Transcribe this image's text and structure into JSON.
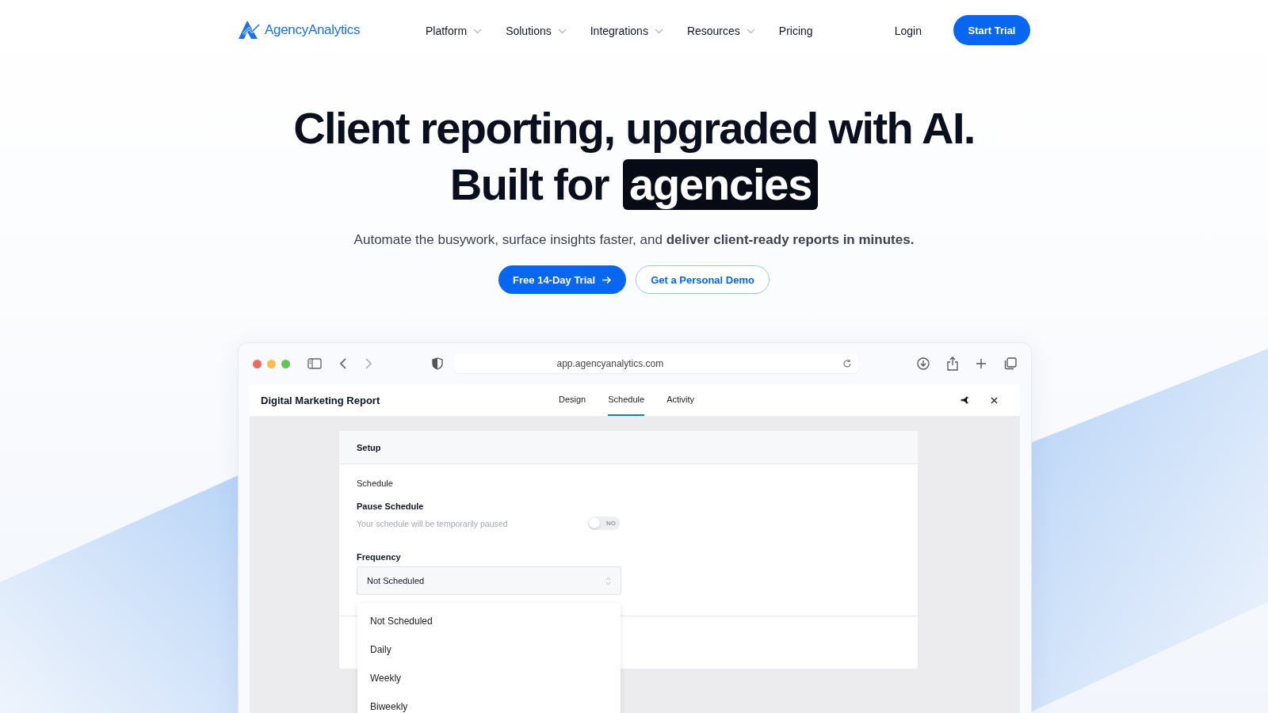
{
  "nav": {
    "logo": "Agency**Analytics**",
    "items": [
      {
        "label": "Platform",
        "has_menu": true
      },
      {
        "label": "Solutions",
        "has_menu": true
      },
      {
        "label": "Integrations",
        "has_menu": true
      },
      {
        "label": "Resources",
        "has_menu": true
      },
      {
        "label": "Pricing",
        "has_menu": false
      }
    ],
    "login": "Login",
    "cta": "Start Trial"
  },
  "hero": {
    "line1": "Client reporting, upgraded with AI.",
    "line2": "Built for",
    "highlight": "agencies",
    "subtitle": "Automate the busywork, surface insights faster, and **deliver client-ready reports in minutes.**",
    "primary_button": "Free 14-Day Trial",
    "secondary_button": "Get a Personal Demo"
  },
  "browser": {
    "url": "app.agencyanalytics.com",
    "app": {
      "title": "Digital Marketing Report",
      "tabs": [
        {
          "label": "Design",
          "selected": false
        },
        {
          "label": "Schedule",
          "selected": true
        },
        {
          "label": "Activity",
          "selected": false
        }
      ],
      "card": {
        "header": "Setup",
        "section": "Schedule",
        "pause_label": "Pause Schedule",
        "pause_hint": "Your schedule will be temporarily paused",
        "toggle": {
          "on": false,
          "label": "NO"
        },
        "frequency_label": "Frequency",
        "select_value": "Not Scheduled",
        "options": [
          {
            "label": "Not Scheduled",
            "selected": false
          },
          {
            "label": "Daily",
            "selected": false
          },
          {
            "label": "Weekly",
            "selected": false
          },
          {
            "label": "Biweekly",
            "selected": false
          }
        ]
      }
    }
  }
}
